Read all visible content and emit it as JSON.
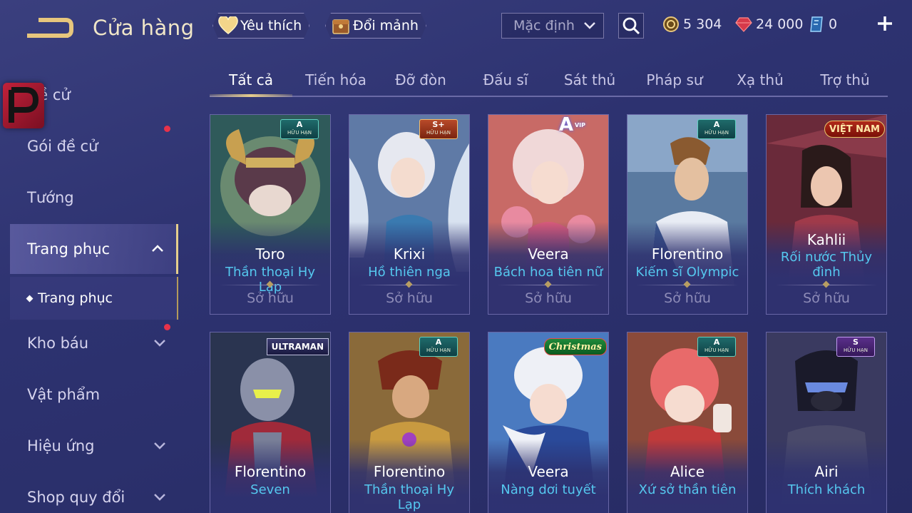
{
  "header": {
    "title": "Cửa hàng",
    "favorite_label": "Yêu thích",
    "exchange_label": "Đổi mảnh",
    "sort_value": "Mặc định",
    "currencies": [
      {
        "name": "gold",
        "value": "5 304",
        "color": "#d8b56a"
      },
      {
        "name": "ruby",
        "value": "24 000",
        "color": "#e84a5a"
      },
      {
        "name": "voucher",
        "value": "0",
        "color": "#6ab8f0"
      }
    ]
  },
  "sidebar": {
    "items": [
      {
        "label": "Đề cử"
      },
      {
        "label": "Gói đề cử"
      },
      {
        "label": "Tướng"
      },
      {
        "label": "Trang phục"
      },
      {
        "label": "Kho báu"
      },
      {
        "label": "Vật phẩm"
      },
      {
        "label": "Hiệu ứng"
      },
      {
        "label": "Shop quy đổi"
      }
    ],
    "sub_item": "Trang phục"
  },
  "tabs": [
    "Tất cả",
    "Tiến hóa",
    "Đỡ đòn",
    "Đấu sĩ",
    "Sát thủ",
    "Pháp sư",
    "Xạ thủ",
    "Trợ thủ"
  ],
  "cards": [
    {
      "hero": "Toro",
      "skin": "Thần thoại Hy Lạp",
      "status": "Sở hữu",
      "badge": "A",
      "badge_sub": "HỮU HẠN"
    },
    {
      "hero": "Krixi",
      "skin": "Hồ thiên nga",
      "status": "Sở hữu",
      "badge": "S+",
      "badge_sub": "HỮU HẠN"
    },
    {
      "hero": "Veera",
      "skin": "Bách hoa tiên nữ",
      "status": "Sở hữu",
      "badge": "A",
      "badge_sub": "VIP"
    },
    {
      "hero": "Florentino",
      "skin": "Kiếm sĩ Olympic",
      "status": "Sở hữu",
      "badge": "A",
      "badge_sub": "HỮU HẠN"
    },
    {
      "hero": "Kahlii",
      "skin": "Rối nước Thủy đình",
      "status": "Sở hữu",
      "badge": "VIỆT NAM"
    },
    {
      "hero": "Florentino",
      "skin": "Seven",
      "badge": "ULTRAMAN"
    },
    {
      "hero": "Florentino",
      "skin": "Thần thoại Hy Lạp",
      "badge": "A",
      "badge_sub": "HỮU HẠN"
    },
    {
      "hero": "Veera",
      "skin": "Nàng dơi tuyết",
      "badge": "Christmas"
    },
    {
      "hero": "Alice",
      "skin": "Xứ sở thần tiên",
      "badge": "A",
      "badge_sub": "HỮU HẠN"
    },
    {
      "hero": "Airi",
      "skin": "Thích khách",
      "badge": "S",
      "badge_sub": "HỮU HẠN"
    }
  ],
  "colors": {
    "accent_gold": "#e6cd8c",
    "skin_name": "#55c8ef",
    "notification": "#e8324a"
  },
  "icons": [
    "back-arrow-icon",
    "heart-icon",
    "chest-icon",
    "chevron-down-icon",
    "search-icon",
    "coin-icon",
    "ruby-icon",
    "voucher-icon",
    "plus-icon",
    "chevron-up-icon",
    "p-logo-icon"
  ]
}
